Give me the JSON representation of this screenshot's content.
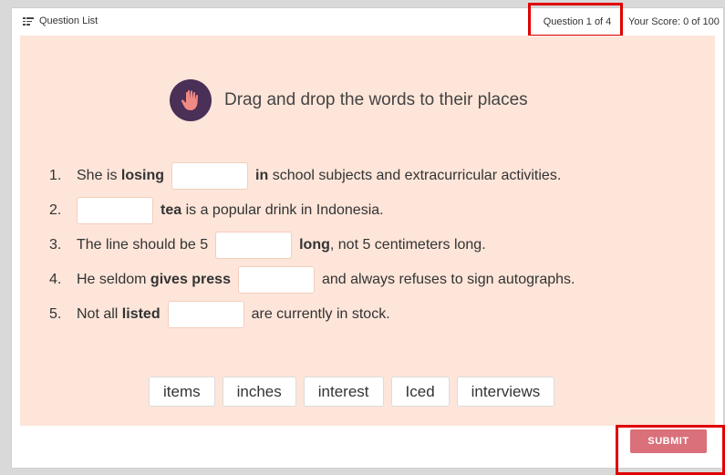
{
  "topbar": {
    "question_list_label": "Question List",
    "question_counter": "Question 1 of 4",
    "score": "Your Score: 0 of 100"
  },
  "header": {
    "title": "Drag and drop the words to their places",
    "icon": "hand-drag-icon"
  },
  "sentences": [
    {
      "number": "1.",
      "parts": [
        "She is ",
        "losing",
        "in",
        " school subjects and extracurricular activities."
      ]
    },
    {
      "number": "2.",
      "parts": [
        "tea",
        " is a popular drink in Indonesia."
      ]
    },
    {
      "number": "3.",
      "parts": [
        "The line should be 5",
        "long",
        ", not 5 centimeters long."
      ]
    },
    {
      "number": "4.",
      "parts": [
        "He seldom ",
        "gives press",
        "and always refuses to sign autographs."
      ]
    },
    {
      "number": "5.",
      "parts": [
        "Not all ",
        "listed",
        "are currently in stock."
      ]
    }
  ],
  "word_bank": [
    "items",
    "inches",
    "interest",
    "Iced",
    "interviews"
  ],
  "submit_label": "SUBMIT",
  "colors": {
    "panel": "#fde5d9",
    "icon_bg": "#4a2f57",
    "submit": "#d9707a",
    "highlight": "#e00000"
  }
}
